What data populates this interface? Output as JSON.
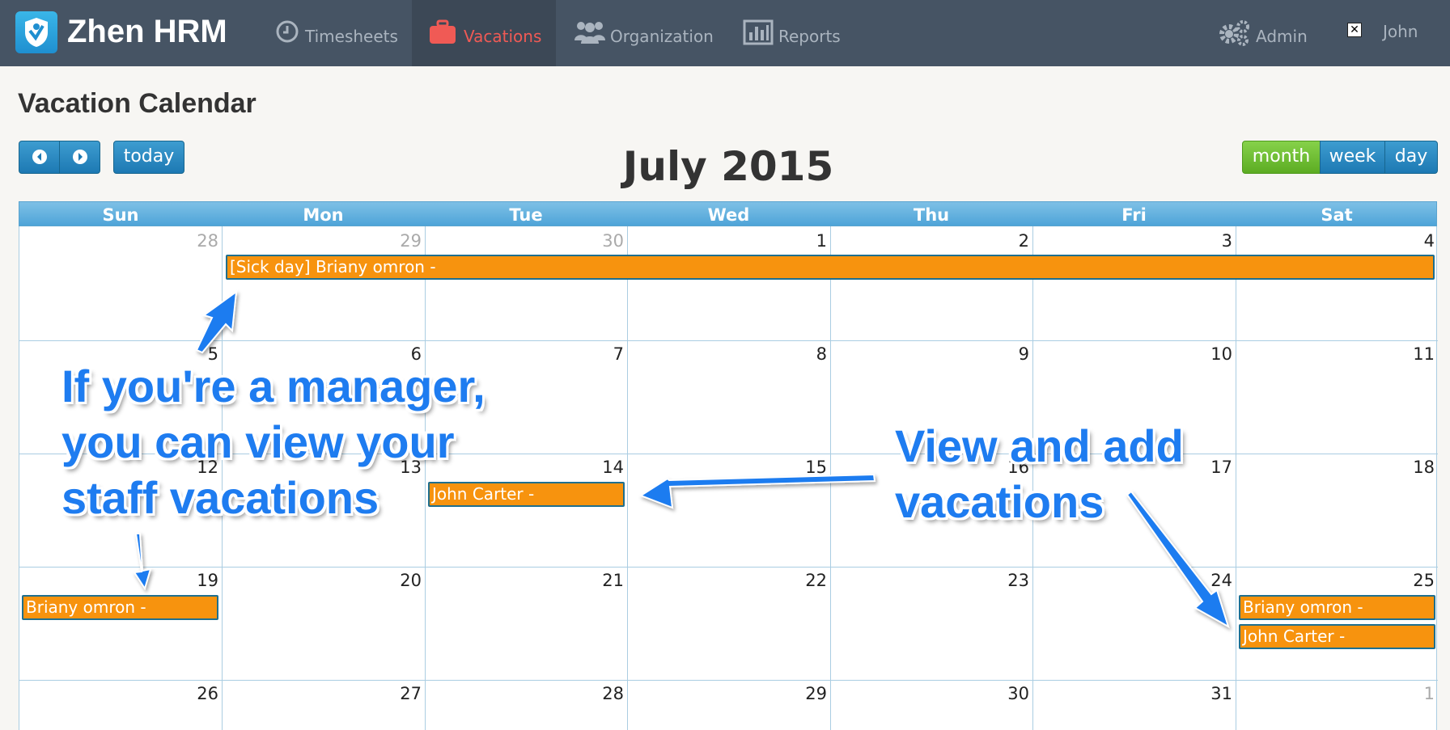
{
  "app": {
    "name": "Zhen HRM"
  },
  "nav": {
    "timesheets": "Timesheets",
    "vacations": "Vacations",
    "organization": "Organization",
    "reports": "Reports",
    "admin": "Admin",
    "user": "John"
  },
  "page": {
    "title": "Vacation Calendar"
  },
  "toolbar": {
    "today": "today",
    "month": "month",
    "week": "week",
    "day": "day"
  },
  "calendar": {
    "title": "July 2015",
    "weekdays": [
      "Sun",
      "Mon",
      "Tue",
      "Wed",
      "Thu",
      "Fri",
      "Sat"
    ],
    "weeks": [
      [
        "28",
        "29",
        "30",
        "1",
        "2",
        "3",
        "4"
      ],
      [
        "5",
        "6",
        "7",
        "8",
        "9",
        "10",
        "11"
      ],
      [
        "12",
        "13",
        "14",
        "15",
        "16",
        "17",
        "18"
      ],
      [
        "19",
        "20",
        "21",
        "22",
        "23",
        "24",
        "25"
      ],
      [
        "26",
        "27",
        "28",
        "29",
        "30",
        "31",
        "1"
      ]
    ],
    "events": [
      {
        "title": "[Sick day] Briany omron -"
      },
      {
        "title": "John Carter -"
      },
      {
        "title": "Briany omron -"
      },
      {
        "title": "Briany omron -"
      },
      {
        "title": "John Carter -"
      }
    ]
  },
  "annotations": {
    "manager_line1": "If you're a manager,",
    "manager_line2": "you can view your",
    "manager_line3": "staff vacations",
    "view_line1": "View and add",
    "view_line2": "vacations"
  },
  "colors": {
    "topbar": "#465464",
    "active_nav": "#f05a55",
    "event": "#f7930e",
    "month_button": "#6cbf2e",
    "callout_text": "#1e7cf0"
  }
}
